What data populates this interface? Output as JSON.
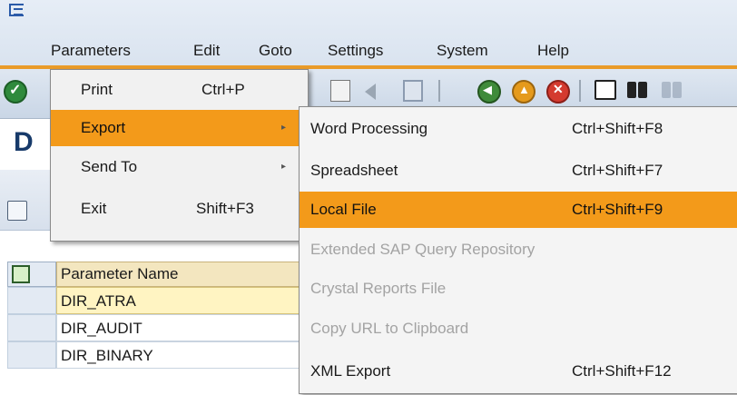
{
  "menubar": {
    "items": [
      {
        "label": "Parameters",
        "mnemonic": "P"
      },
      {
        "label": "Edit",
        "mnemonic": "E"
      },
      {
        "label": "Goto",
        "mnemonic": "G"
      },
      {
        "label": "Settings",
        "mnemonic": "S"
      },
      {
        "label": "System",
        "mnemonic": "y"
      },
      {
        "label": "Help",
        "mnemonic": "H"
      }
    ]
  },
  "page": {
    "title_partial": "D"
  },
  "table": {
    "header": "Parameter Name",
    "rows": [
      "DIR_ATRA",
      "DIR_AUDIT",
      "DIR_BINARY"
    ]
  },
  "parameters_menu": {
    "items": [
      {
        "label": "Print",
        "accel": "Ctrl+P"
      },
      {
        "label": "Export",
        "accel": "",
        "submenu": true,
        "highlighted": true
      },
      {
        "label": "Send To",
        "accel": "",
        "submenu": true
      },
      {
        "label": "Exit",
        "accel": "Shift+F3"
      }
    ]
  },
  "export_menu": {
    "items": [
      {
        "label": "Word Processing",
        "accel": "Ctrl+Shift+F8",
        "enabled": true
      },
      {
        "label": "Spreadsheet",
        "accel": "Ctrl+Shift+F7",
        "enabled": true
      },
      {
        "label": "Local File",
        "accel": "Ctrl+Shift+F9",
        "enabled": true,
        "highlighted": true
      },
      {
        "label": "Extended SAP Query Repository",
        "accel": "",
        "enabled": false
      },
      {
        "label": "Crystal Reports File",
        "accel": "",
        "enabled": false
      },
      {
        "label": "Copy URL to Clipboard",
        "accel": "",
        "enabled": false
      },
      {
        "label": "XML Export",
        "accel": "Ctrl+Shift+F12",
        "enabled": true
      }
    ]
  },
  "colors": {
    "highlight": "#f39a1a",
    "orange_rule": "#e99b29",
    "header_bg": "#f3e6bf",
    "selected_row": "#fff4c2"
  }
}
